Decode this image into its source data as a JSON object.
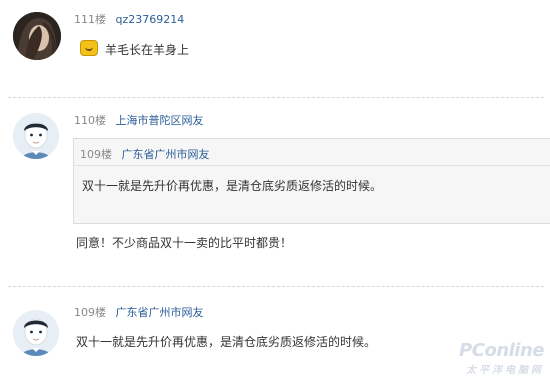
{
  "comments": [
    {
      "floor": "111楼",
      "user": "qz23769214",
      "text": "羊毛长在羊身上",
      "avatar_icon": "girl-photo-avatar",
      "badge_icon": "grin-emoji"
    },
    {
      "floor": "110楼",
      "user": "上海市普陀区网友",
      "quote": {
        "floor": "109楼",
        "user": "广东省广州市网友",
        "text": "双十一就是先升价再优惠，是清仓底劣质返修活的时候。"
      },
      "text": "同意！不少商品双十一卖的比平时都贵！",
      "avatar_icon": "default-user-avatar"
    },
    {
      "floor": "109楼",
      "user": "广东省广州市网友",
      "text": "双十一就是先升价再优惠，是清仓底劣质返修活的时候。",
      "avatar_icon": "default-user-avatar"
    }
  ],
  "watermark": {
    "line1": "PConline",
    "line2": "太平洋电脑网"
  },
  "colors": {
    "username": "#2a5d99",
    "floor": "#888888",
    "quote_bg": "#f6f6f6"
  }
}
